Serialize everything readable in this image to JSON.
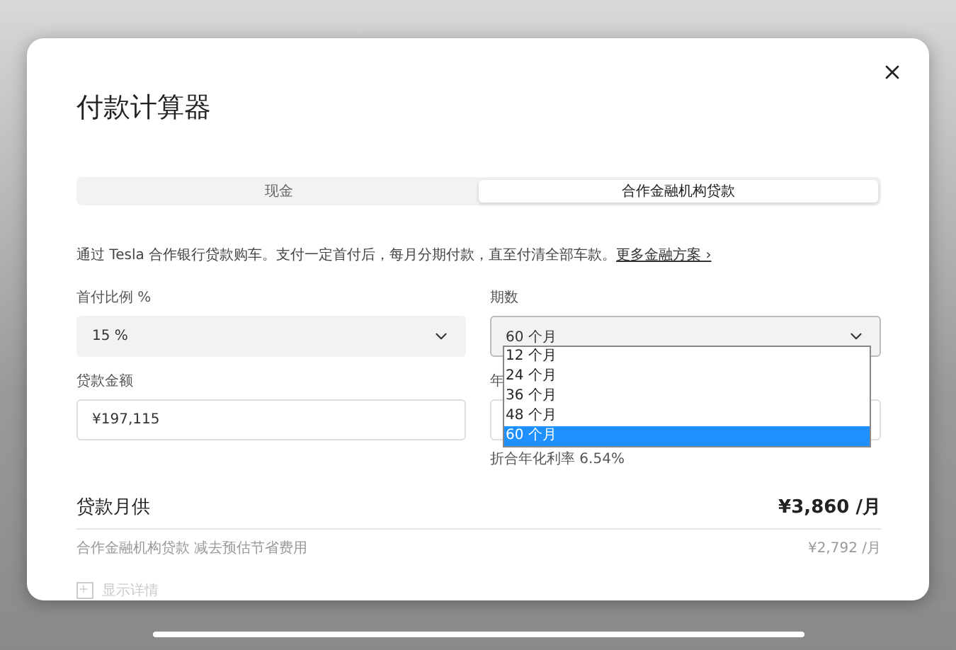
{
  "dialog": {
    "title": "付款计算器"
  },
  "tabs": [
    {
      "label": "现金",
      "selected": false
    },
    {
      "label": "合作金融机构贷款",
      "selected": true
    }
  ],
  "description": {
    "text": "通过 Tesla 合作银行贷款购车。支付一定首付后，每月分期付款，直至付清全部车款。",
    "link": "更多金融方案 ›"
  },
  "down_payment": {
    "label": "首付比例 %",
    "value": "15 %"
  },
  "term": {
    "label": "期数",
    "value": "60 个月",
    "expanded": true,
    "options": [
      {
        "label": "12 个月",
        "selected": false
      },
      {
        "label": "24 个月",
        "selected": false
      },
      {
        "label": "36 个月",
        "selected": false
      },
      {
        "label": "48 个月",
        "selected": false
      },
      {
        "label": "60 个月",
        "selected": true
      }
    ]
  },
  "loan_amount": {
    "label": "贷款金额",
    "value": "¥197,115"
  },
  "rate": {
    "label": "年",
    "note": "折合年化利率 6.54%"
  },
  "monthly": {
    "label": "贷款月供",
    "value": "¥3,860 /月"
  },
  "savings": {
    "label": "合作金融机构贷款 减去预估节省费用",
    "value": "¥2,792 /月"
  },
  "details": {
    "label": "显示详情",
    "checked": false
  }
}
